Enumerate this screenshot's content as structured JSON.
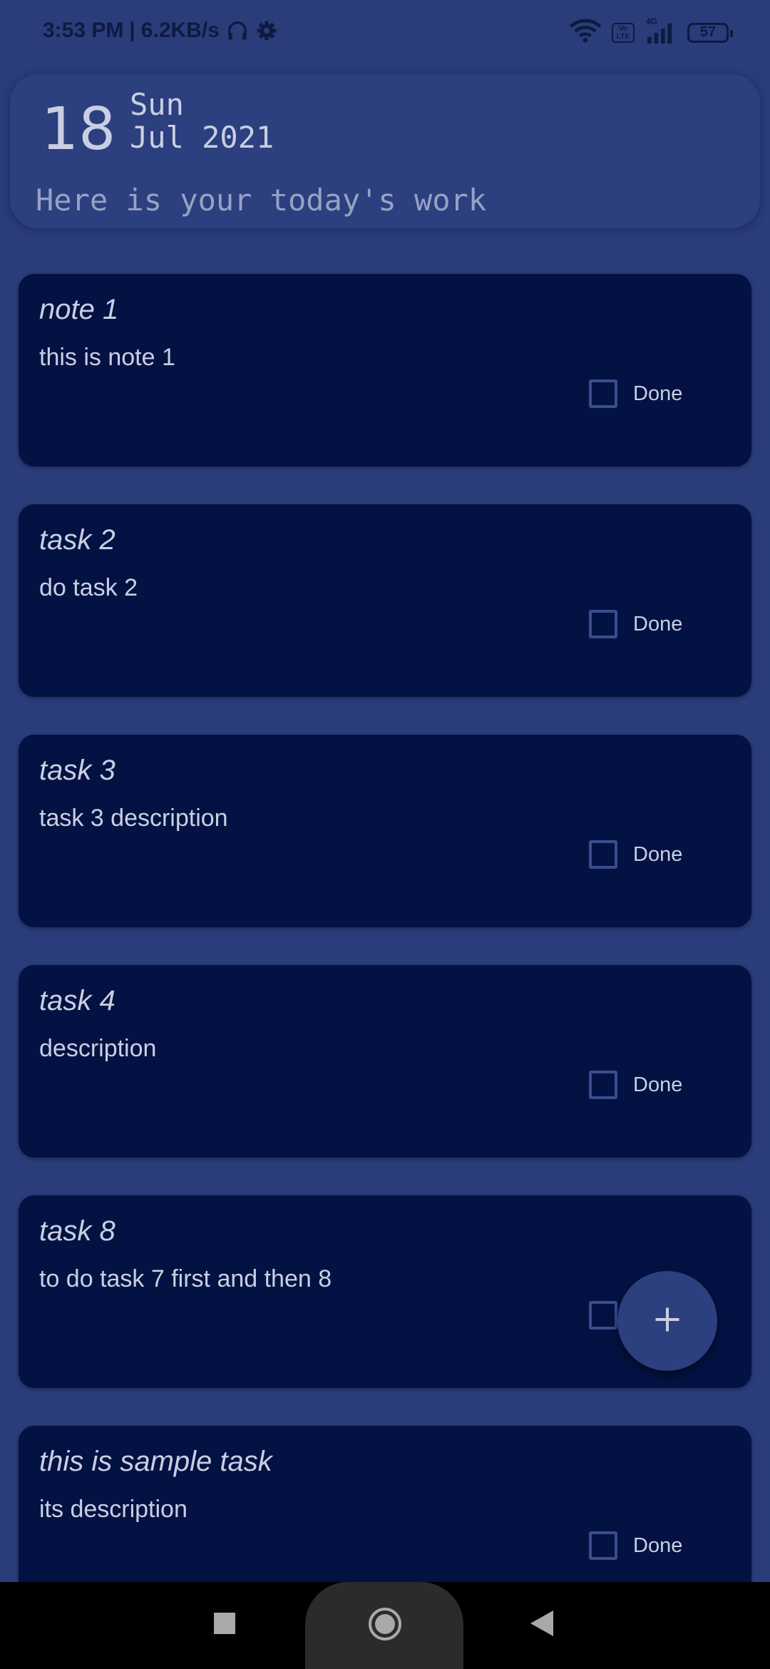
{
  "status_bar": {
    "time": "3:53 PM",
    "separator": "|",
    "network_speed": "6.2KB/s",
    "battery": "57",
    "volte_label_top": "Vo",
    "volte_label_bottom": "LTE",
    "signal_label": "4G",
    "icons": [
      "headphones-icon",
      "gear-icon",
      "wifi-icon",
      "volte-icon",
      "signal-icon",
      "battery-icon"
    ]
  },
  "header": {
    "day": "18",
    "weekday": "Sun",
    "month_year": "Jul 2021",
    "subtitle": "Here is your today's work"
  },
  "tasks": [
    {
      "title": "note 1",
      "description": "this is note 1",
      "done_label": "Done",
      "done": false
    },
    {
      "title": "task 2",
      "description": "do task 2",
      "done_label": "Done",
      "done": false
    },
    {
      "title": "task 3",
      "description": "task 3 description",
      "done_label": "Done",
      "done": false
    },
    {
      "title": "task 4",
      "description": "description",
      "done_label": "Done",
      "done": false
    },
    {
      "title": "task 8",
      "description": "to do task 7 first and then 8",
      "done_label": "",
      "done": false
    },
    {
      "title": "this is sample task",
      "description": "its description",
      "done_label": "Done",
      "done": false
    }
  ],
  "fab": {
    "icon": "plus-icon"
  },
  "nav_bar": {
    "icons": [
      "recents-square-icon",
      "home-circle-icon",
      "back-triangle-icon"
    ]
  },
  "colors": {
    "background": "#2a3c7a",
    "card": "#031243",
    "header_card": "#2c3f7f",
    "text": "#c9cfe2",
    "checkbox_border": "#3a4e8e"
  }
}
